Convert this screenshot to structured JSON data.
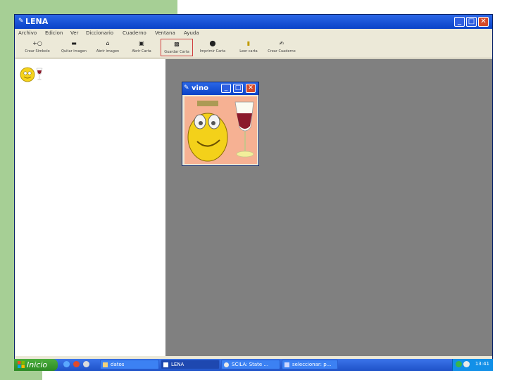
{
  "window": {
    "title": "LENA"
  },
  "menu": [
    "Archivo",
    "Edicion",
    "Ver",
    "Diccionario",
    "Cuaderno",
    "Ventana",
    "Ayuda"
  ],
  "toolbar": [
    {
      "label": "Crear Símbolo",
      "icon": "new-symbol-icon"
    },
    {
      "label": "Quitar imagen",
      "icon": "remove-image-icon"
    },
    {
      "label": "Abrir imagen",
      "icon": "open-image-icon"
    },
    {
      "label": "Abrir Carta",
      "icon": "open-letter-icon"
    },
    {
      "label": "Guardar Carta",
      "icon": "save-letter-icon"
    },
    {
      "label": "Imprimir Carta",
      "icon": "print-letter-icon"
    },
    {
      "label": "Leer carta",
      "icon": "read-letter-icon"
    },
    {
      "label": "Crear Cuaderno",
      "icon": "create-notebook-icon"
    }
  ],
  "child_window": {
    "title": "vino"
  },
  "taskbar": {
    "start_label": "Inicio",
    "buttons": [
      "datos",
      "LENA",
      "SCILA: State ...",
      "seleccionar: p..."
    ],
    "clock": "13:41"
  }
}
